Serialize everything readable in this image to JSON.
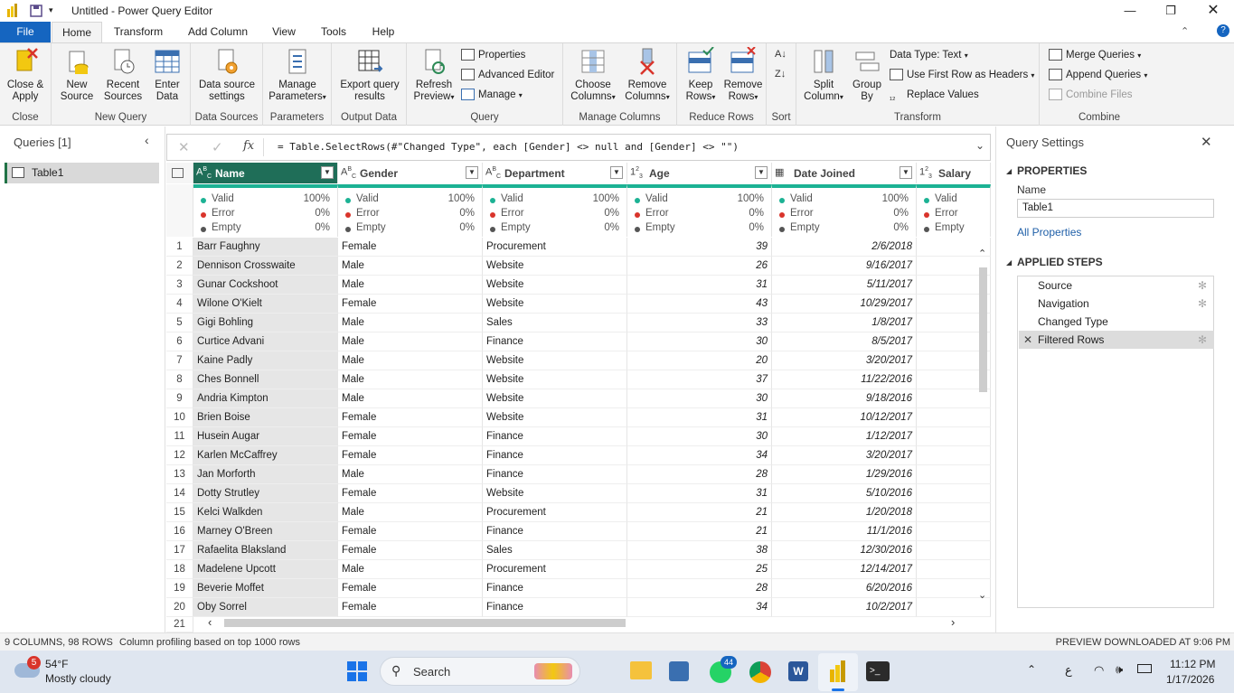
{
  "window": {
    "title": "Untitled - Power Query Editor"
  },
  "ribbon_tabs": [
    "File",
    "Home",
    "Transform",
    "Add Column",
    "View",
    "Tools",
    "Help"
  ],
  "ribbon": {
    "close_apply": "Close &\nApply",
    "new_source": "New\nSource",
    "recent_sources": "Recent\nSources",
    "enter_data": "Enter\nData",
    "data_source_settings": "Data source\nsettings",
    "manage_parameters": "Manage\nParameters",
    "export_query": "Export query\nresults",
    "refresh_preview": "Refresh\nPreview",
    "properties": "Properties",
    "advanced_editor": "Advanced Editor",
    "manage": "Manage",
    "choose_columns": "Choose\nColumns",
    "remove_columns": "Remove\nColumns",
    "keep_rows": "Keep\nRows",
    "remove_rows": "Remove\nRows",
    "split_column": "Split\nColumn",
    "group_by": "Group\nBy",
    "data_type": "Data Type: Text",
    "use_first_row": "Use First Row as Headers",
    "replace_values": "Replace Values",
    "merge_queries": "Merge Queries",
    "append_queries": "Append Queries",
    "combine_files": "Combine Files",
    "groups": [
      "Close",
      "New Query",
      "Data Sources",
      "Parameters",
      "Output Data",
      "Query",
      "Manage Columns",
      "Reduce Rows",
      "Sort",
      "Transform",
      "Combine"
    ]
  },
  "queries": {
    "title": "Queries [1]",
    "items": [
      "Table1"
    ]
  },
  "formula": "= Table.SelectRows(#\"Changed Type\", each [Gender] <> null and [Gender] <> \"\")",
  "columns": [
    {
      "type": "ABC",
      "name": "Name"
    },
    {
      "type": "ABC",
      "name": "Gender"
    },
    {
      "type": "ABC",
      "name": "Department"
    },
    {
      "type": "123",
      "name": "Age"
    },
    {
      "type": "cal",
      "name": "Date Joined"
    },
    {
      "type": "123",
      "name": "Salary"
    }
  ],
  "profile": {
    "valid": "Valid",
    "error": "Error",
    "empty": "Empty",
    "valid_pct": "100%",
    "error_pct": "0%",
    "empty_pct": "0%"
  },
  "rows": [
    [
      "Barr Faughny",
      "Female",
      "Procurement",
      "39",
      "2/6/2018"
    ],
    [
      "Dennison Crosswaite",
      "Male",
      "Website",
      "26",
      "9/16/2017"
    ],
    [
      "Gunar Cockshoot",
      "Male",
      "Website",
      "31",
      "5/11/2017"
    ],
    [
      "Wilone O'Kielt",
      "Female",
      "Website",
      "43",
      "10/29/2017"
    ],
    [
      "Gigi Bohling",
      "Male",
      "Sales",
      "33",
      "1/8/2017"
    ],
    [
      "Curtice Advani",
      "Male",
      "Finance",
      "30",
      "8/5/2017"
    ],
    [
      "Kaine Padly",
      "Male",
      "Website",
      "20",
      "3/20/2017"
    ],
    [
      "Ches Bonnell",
      "Male",
      "Website",
      "37",
      "11/22/2016"
    ],
    [
      "Andria Kimpton",
      "Male",
      "Website",
      "30",
      "9/18/2016"
    ],
    [
      "Brien Boise",
      "Female",
      "Website",
      "31",
      "10/12/2017"
    ],
    [
      "Husein Augar",
      "Female",
      "Finance",
      "30",
      "1/12/2017"
    ],
    [
      "Karlen McCaffrey",
      "Female",
      "Finance",
      "34",
      "3/20/2017"
    ],
    [
      "Jan Morforth",
      "Male",
      "Finance",
      "28",
      "1/29/2016"
    ],
    [
      "Dotty Strutley",
      "Female",
      "Website",
      "31",
      "5/10/2016"
    ],
    [
      "Kelci Walkden",
      "Male",
      "Procurement",
      "21",
      "1/20/2018"
    ],
    [
      "Marney O'Breen",
      "Female",
      "Finance",
      "21",
      "11/1/2016"
    ],
    [
      "Rafaelita Blaksland",
      "Female",
      "Sales",
      "38",
      "12/30/2016"
    ],
    [
      "Madelene Upcott",
      "Male",
      "Procurement",
      "25",
      "12/14/2017"
    ],
    [
      "Beverie Moffet",
      "Female",
      "Finance",
      "28",
      "6/20/2016"
    ],
    [
      "Oby Sorrel",
      "Female",
      "Finance",
      "34",
      "10/2/2017"
    ]
  ],
  "last_row_number": "21",
  "settings": {
    "title": "Query Settings",
    "properties_header": "PROPERTIES",
    "name_label": "Name",
    "name_value": "Table1",
    "all_properties": "All Properties",
    "steps_header": "APPLIED STEPS",
    "steps": [
      "Source",
      "Navigation",
      "Changed Type",
      "Filtered Rows"
    ]
  },
  "status": {
    "left": "9 COLUMNS, 98 ROWS",
    "profiling": "Column profiling based on top 1000 rows",
    "right": "PREVIEW DOWNLOADED AT 9:06 PM"
  },
  "taskbar": {
    "temp": "54°F",
    "weather": "Mostly cloudy",
    "weather_badge": "5",
    "search": "Search",
    "whatsapp_badge": "44",
    "lang": "ع",
    "time": "11:12 PM",
    "date": "1/17/2026"
  },
  "colors": {
    "accent": "#217346",
    "file_tab": "#1565c0",
    "profile_bar": "#1cb294",
    "selected_header": "#1f6e58"
  }
}
